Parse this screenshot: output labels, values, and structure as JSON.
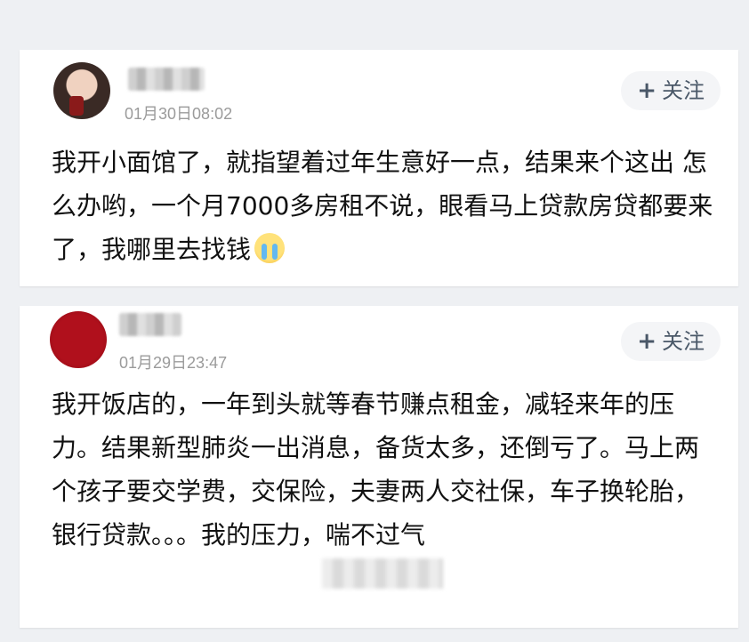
{
  "comments": [
    {
      "timestamp": "01月30日08:02",
      "follow_label": "关注",
      "text": "我开小面馆了，就指望着过年生意好一点，结果来个这出 怎么办哟，一个月7000多房租不说，眼看马上贷款房贷都要来了，我哪里去找钱",
      "emoji": "crying-face-icon"
    },
    {
      "timestamp": "01月29日23:47",
      "follow_label": "关注",
      "text": "我开饭店的，一年到头就等春节赚点租金，减轻来年的压力。结果新型肺炎一出消息，备货太多，还倒亏了。马上两个孩子要交学费，交保险，夫妻两人交社保，车子换轮胎，银行贷款。。。我的压力，喘不过气"
    }
  ],
  "colors": {
    "background": "#eef0f3",
    "card": "#ffffff",
    "timestamp": "#9b9b9b",
    "follow_text": "#4a5868",
    "follow_bg": "#f4f5f7"
  }
}
